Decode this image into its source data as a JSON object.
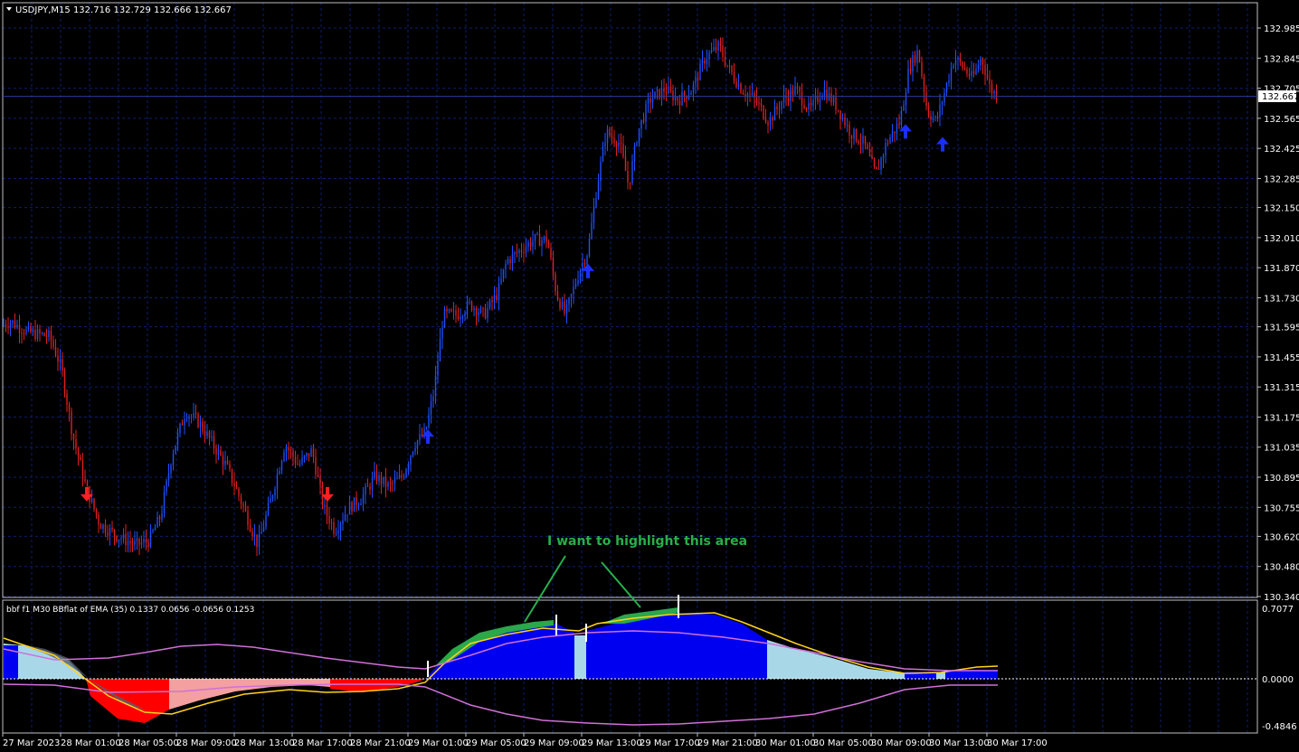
{
  "main": {
    "header": "USDJPY,M15  132.716 132.729 132.666 132.667",
    "price_labels": [
      "132.985",
      "132.845",
      "132.705",
      "132.565",
      "132.425",
      "132.285",
      "132.150",
      "132.010",
      "131.870",
      "131.730",
      "131.595",
      "131.455",
      "131.315",
      "131.175",
      "131.035",
      "130.895",
      "130.755",
      "130.620",
      "130.480",
      "130.340"
    ],
    "current_price": "132.667",
    "price_min": 130.34,
    "price_max": 132.985
  },
  "indicator": {
    "header": "bbf f1 M30 BBflat of EMA (35) 0.1337 0.0656 -0.0656 0.1253",
    "top_label": "0.7077",
    "zero_label": "0.0000",
    "bottom_label": "-0.4846"
  },
  "annotation": {
    "text": "I want to highlight this area"
  },
  "time_labels": [
    "27 Mar 2023",
    "28 Mar 01:00",
    "28 Mar 05:00",
    "28 Mar 09:00",
    "28 Mar 13:00",
    "28 Mar 17:00",
    "28 Mar 21:00",
    "29 Mar 01:00",
    "29 Mar 05:00",
    "29 Mar 09:00",
    "29 Mar 13:00",
    "29 Mar 17:00",
    "29 Mar 21:00",
    "30 Mar 01:00",
    "30 Mar 05:00",
    "30 Mar 09:00",
    "30 Mar 13:00",
    "30 Mar 17:00"
  ],
  "colors": {
    "bull": "#1e50ff",
    "bear": "#e02020",
    "grid": "#0d1e6e",
    "up_arrow": "#1a2fff",
    "down_arrow": "#ff2020",
    "hist_blue": "#0000f0",
    "hist_lightblue": "#a8d8e8",
    "hist_red": "#ff0000",
    "hist_pink": "#f4a0a0",
    "fill_green": "#2aa84a",
    "line_yellow": "#ffd21e",
    "line_violet": "#d070d8",
    "annotation": "#27b04a"
  },
  "chart_data": {
    "type": "candlestick",
    "symbol": "USDJPY",
    "timeframe": "M15",
    "ohlc_last": {
      "open": 132.716,
      "high": 132.729,
      "low": 132.666,
      "close": 132.667
    },
    "ylim": [
      130.34,
      132.985
    ],
    "price_path": [
      [
        0,
        131.6
      ],
      [
        12,
        131.62
      ],
      [
        30,
        131.57
      ],
      [
        55,
        131.55
      ],
      [
        68,
        131.4
      ],
      [
        80,
        131.1
      ],
      [
        95,
        130.85
      ],
      [
        110,
        130.68
      ],
      [
        130,
        130.62
      ],
      [
        150,
        130.58
      ],
      [
        165,
        130.6
      ],
      [
        178,
        130.72
      ],
      [
        190,
        131.0
      ],
      [
        205,
        131.2
      ],
      [
        220,
        131.15
      ],
      [
        235,
        131.05
      ],
      [
        250,
        130.95
      ],
      [
        265,
        130.8
      ],
      [
        285,
        130.58
      ],
      [
        300,
        130.8
      ],
      [
        315,
        131.05
      ],
      [
        330,
        130.95
      ],
      [
        345,
        131.02
      ],
      [
        358,
        130.75
      ],
      [
        370,
        130.65
      ],
      [
        385,
        130.75
      ],
      [
        400,
        130.8
      ],
      [
        415,
        130.9
      ],
      [
        430,
        130.85
      ],
      [
        445,
        130.9
      ],
      [
        458,
        131.05
      ],
      [
        470,
        131.1
      ],
      [
        480,
        131.3
      ],
      [
        490,
        131.65
      ],
      [
        505,
        131.65
      ],
      [
        520,
        131.7
      ],
      [
        535,
        131.65
      ],
      [
        550,
        131.75
      ],
      [
        560,
        131.9
      ],
      [
        575,
        131.95
      ],
      [
        590,
        132.0
      ],
      [
        605,
        132.0
      ],
      [
        615,
        131.75
      ],
      [
        625,
        131.65
      ],
      [
        640,
        131.85
      ],
      [
        650,
        131.95
      ],
      [
        660,
        132.25
      ],
      [
        670,
        132.5
      ],
      [
        685,
        132.45
      ],
      [
        695,
        132.25
      ],
      [
        705,
        132.5
      ],
      [
        718,
        132.65
      ],
      [
        735,
        132.7
      ],
      [
        750,
        132.65
      ],
      [
        765,
        132.7
      ],
      [
        780,
        132.85
      ],
      [
        795,
        132.9
      ],
      [
        805,
        132.8
      ],
      [
        820,
        132.7
      ],
      [
        835,
        132.65
      ],
      [
        850,
        132.55
      ],
      [
        865,
        132.65
      ],
      [
        880,
        132.7
      ],
      [
        895,
        132.6
      ],
      [
        910,
        132.7
      ],
      [
        925,
        132.62
      ],
      [
        940,
        132.5
      ],
      [
        955,
        132.45
      ],
      [
        968,
        132.3
      ],
      [
        980,
        132.45
      ],
      [
        995,
        132.55
      ],
      [
        1005,
        132.8
      ],
      [
        1015,
        132.88
      ],
      [
        1025,
        132.6
      ],
      [
        1035,
        132.55
      ],
      [
        1045,
        132.7
      ],
      [
        1055,
        132.85
      ],
      [
        1065,
        132.8
      ],
      [
        1075,
        132.75
      ],
      [
        1085,
        132.85
      ],
      [
        1095,
        132.7
      ],
      [
        1103,
        132.67
      ]
    ],
    "signals": [
      {
        "type": "down",
        "x": 96,
        "price": 130.82
      },
      {
        "type": "down",
        "x": 362,
        "price": 130.82
      },
      {
        "type": "up",
        "x": 473,
        "price": 131.08
      },
      {
        "type": "up",
        "x": 650,
        "price": 131.85
      },
      {
        "type": "up",
        "x": 1001,
        "price": 132.5
      },
      {
        "type": "up",
        "x": 1042,
        "price": 132.44
      }
    ],
    "indicator_range": [
      -0.4846,
      0.7077
    ]
  }
}
